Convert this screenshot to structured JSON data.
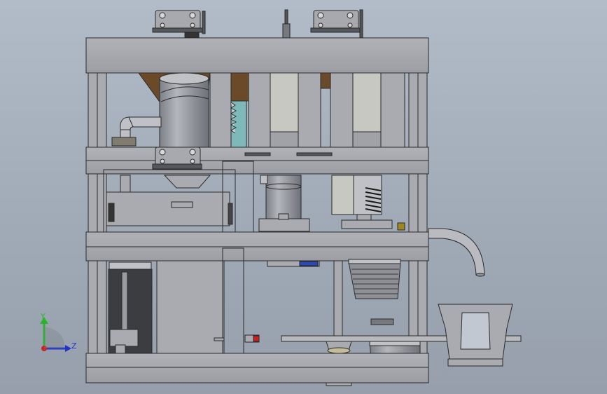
{
  "viewport": {
    "background_top": "#b2bcc8",
    "background_bottom": "#969fab",
    "part_fill": "#a9abb0",
    "part_stroke": "#2a2a2a"
  },
  "triad": {
    "y_label": "Y",
    "z_label": "Z",
    "y_color": "#2bb52b",
    "z_color": "#2233cc",
    "x_color": "#cc2222"
  },
  "accents": {
    "wood": "#6b4a2a",
    "teal": "#7fb8b8",
    "blue_block": "#2b47b8",
    "red_knob": "#cc2020",
    "rod": "#c4bb9a"
  }
}
